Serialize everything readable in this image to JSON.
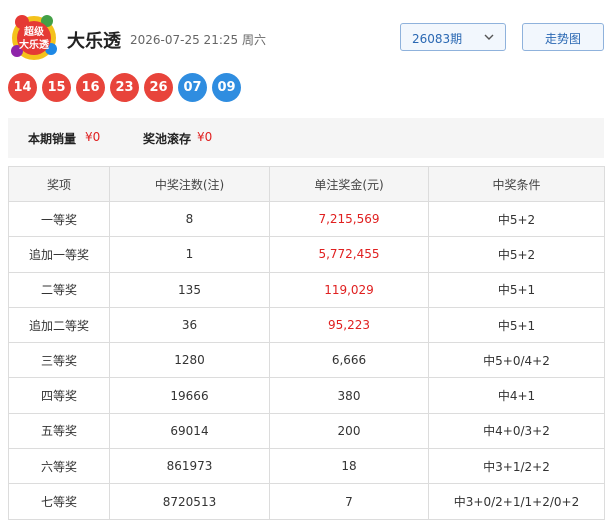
{
  "header": {
    "logo_text_top": "超级",
    "logo_text_bottom": "大乐透",
    "title": "大乐透",
    "draw_time": "2026-07-25 21:25 周六",
    "issue_select": {
      "value": "26083期",
      "icon": "chevron-down-icon"
    },
    "trend_button": "走势图"
  },
  "numbers": {
    "front": [
      "14",
      "15",
      "16",
      "23",
      "26"
    ],
    "back": [
      "07",
      "09"
    ],
    "front_color": "#e8443b",
    "back_color": "#2f8de0"
  },
  "sales": {
    "sales_label": "本期销量",
    "sales_value": "¥0",
    "pool_label": "奖池滚存",
    "pool_value": "¥0"
  },
  "prize_table": {
    "headers": [
      "奖项",
      "中奖注数(注)",
      "单注奖金(元)",
      "中奖条件"
    ],
    "rows": [
      {
        "name": "一等奖",
        "count": "8",
        "amount": "7,215,569",
        "condition": "中5+2"
      },
      {
        "name": "追加一等奖",
        "count": "1",
        "amount": "5,772,455",
        "condition": "中5+2"
      },
      {
        "name": "二等奖",
        "count": "135",
        "amount": "119,029",
        "condition": "中5+1"
      },
      {
        "name": "追加二等奖",
        "count": "36",
        "amount": "95,223",
        "condition": "中5+1"
      },
      {
        "name": "三等奖",
        "count": "1280",
        "amount": "6,666",
        "condition": "中5+0/4+2"
      },
      {
        "name": "四等奖",
        "count": "19666",
        "amount": "380",
        "condition": "中4+1"
      },
      {
        "name": "五等奖",
        "count": "69014",
        "amount": "200",
        "condition": "中4+0/3+2"
      },
      {
        "name": "六等奖",
        "count": "861973",
        "amount": "18",
        "condition": "中3+1/2+2"
      },
      {
        "name": "七等奖",
        "count": "8720513",
        "amount": "7",
        "condition": "中3+0/2+1/1+2/0+2"
      }
    ],
    "highlight_color": "#e02020"
  }
}
